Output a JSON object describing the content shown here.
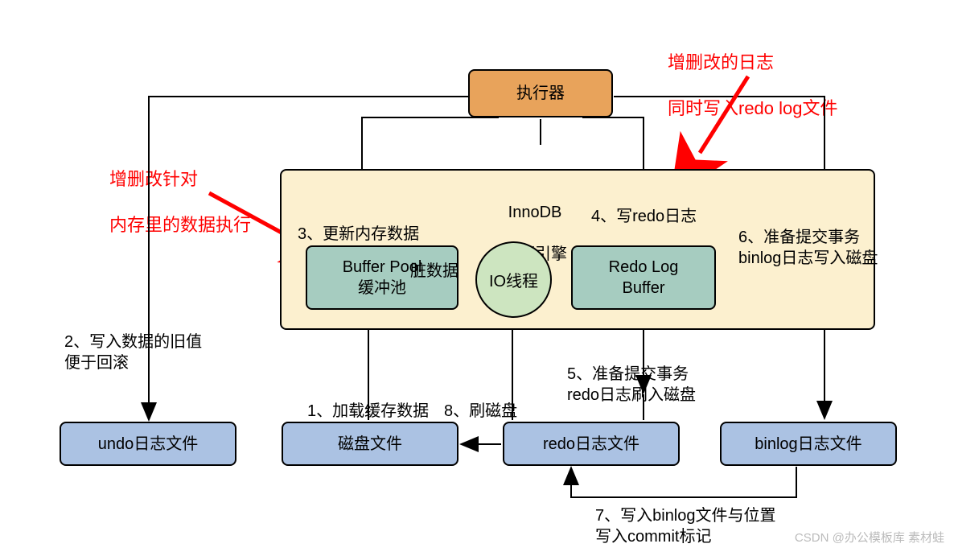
{
  "boxes": {
    "executor": "执行器",
    "engine_l1": "InnoDB",
    "engine_l2": "存储引擎",
    "buffer_pool_l1": "Buffer Pool",
    "buffer_pool_l2": "缓冲池",
    "io_thread": "IO线程",
    "redo_buffer_l1": "Redo Log",
    "redo_buffer_l2": "Buffer",
    "undo_file": "undo日志文件",
    "disk_file": "磁盘文件",
    "redo_file": "redo日志文件",
    "binlog_file": "binlog日志文件"
  },
  "steps": {
    "s1": "1、加载缓存数据",
    "s2": "2、写入数据的旧值\n         便于回滚",
    "s3": "3、更新内存数据",
    "s4": "4、写redo日志",
    "s5": "5、准备提交事务\nredo日志刷入磁盘",
    "s6": "6、准备提交事务\nbinlog日志写入磁盘",
    "s7": "7、写入binlog文件与位置\n     写入commit标记",
    "s8": "8、刷磁盘",
    "dirty": "脏数据"
  },
  "annotations": {
    "left_l1": "增删改针对",
    "left_l2": "内存里的数据执行",
    "right_l1": "增删改的日志",
    "right_l2": "同时写入redo log文件"
  },
  "watermark": "CSDN @办公模板库 素材蛙",
  "colors": {
    "executor": "#e8a35b",
    "engine_bg": "#fcf0cf",
    "green_box": "#a6ccc0",
    "circle_bg": "#cde5c0",
    "blue_box": "#abc2e3",
    "red_arrow": "#ff0000"
  }
}
